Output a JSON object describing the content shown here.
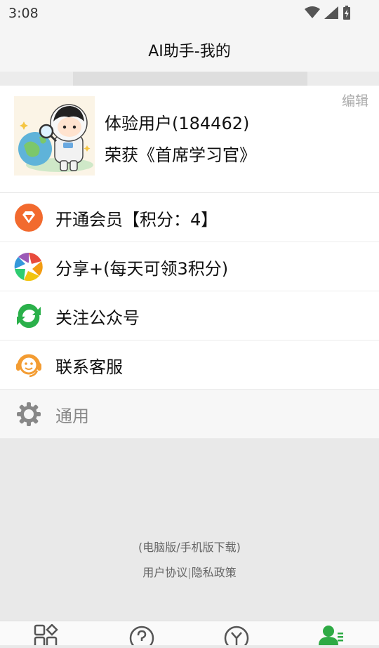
{
  "status_bar": {
    "time": "3:08"
  },
  "header": {
    "title": "AI助手-我的"
  },
  "profile": {
    "edit_label": "编辑",
    "name": "体验用户(184462)",
    "honor": "荣获《首席学习官》"
  },
  "menu": {
    "items": [
      {
        "label": "开通会员【积分：4】",
        "icon": "diamond-icon"
      },
      {
        "label": "分享+(每天可领3积分)",
        "icon": "share-aperture-icon"
      },
      {
        "label": "关注公众号",
        "icon": "wechat-follow-icon"
      },
      {
        "label": "联系客服",
        "icon": "customer-service-icon"
      },
      {
        "label": "通用",
        "icon": "gear-icon"
      }
    ]
  },
  "footer": {
    "download_link": "(电脑版/手机版下载)",
    "agreement_link": "用户协议",
    "separator": "|",
    "privacy_link": "隐私政策"
  },
  "bottom_nav": {
    "items": [
      {
        "icon": "apps-grid-icon"
      },
      {
        "icon": "help-icon"
      },
      {
        "icon": "y-circle-icon"
      },
      {
        "icon": "user-profile-icon",
        "active_color": "#2eaa44"
      }
    ]
  }
}
